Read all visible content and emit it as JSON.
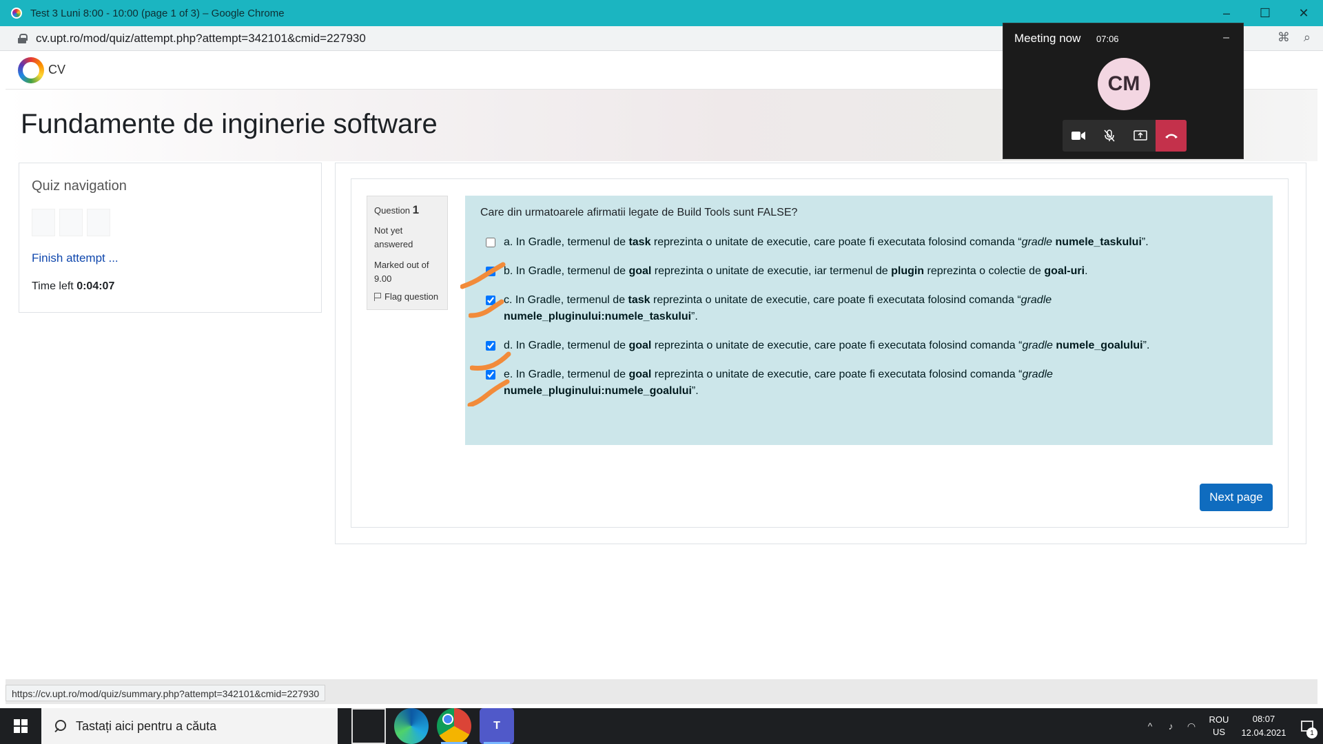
{
  "browser": {
    "window_title": "Test 3 Luni 8:00 - 10:00 (page 1 of 3) – Google Chrome",
    "url": "cv.upt.ro/mod/quiz/attempt.php?attempt=342101&cmid=227930",
    "status_url": "https://cv.upt.ro/mod/quiz/summary.php?attempt=342101&cmid=227930"
  },
  "site": {
    "logo_text": "CV",
    "course_title": "Fundamente de inginerie software"
  },
  "quiz_nav": {
    "heading": "Quiz navigation",
    "finish_attempt": "Finish attempt ...",
    "time_left_label": "Time left",
    "time_left_value": "0:04:07"
  },
  "question": {
    "label": "Question",
    "number": "1",
    "state": "Not yet answered",
    "grade": "Marked out of 9.00",
    "flag": "Flag question",
    "text": "Care din urmatoarele afirmatii legate de Build Tools sunt FALSE?",
    "answers": [
      {
        "prefix": "a. In Gradle, termenul de ",
        "b1": "task",
        "mid": " reprezinta o unitate de executie, care poate fi executata folosind comanda “",
        "em": "gradle",
        "sp": " ",
        "b2": "numele_taskului",
        "end": "”.",
        "checked": false
      },
      {
        "prefix": "b. In Gradle, termenul de ",
        "b1": "goal",
        "mid": " reprezinta o unitate de executie, iar termenul de ",
        "b2": "plugin",
        "mid2": " reprezinta o colectie de ",
        "b3": "goal-uri",
        "end": ".",
        "checked": true
      },
      {
        "prefix": "c. In Gradle, termenul de ",
        "b1": "task",
        "mid": " reprezinta o unitate de executie, care poate fi executata folosind comanda “",
        "em": "gradle",
        "b2": "numele_pluginului:numele_taskului",
        "end": "”.",
        "checked": true
      },
      {
        "prefix": "d. In Gradle, termenul de ",
        "b1": "goal",
        "mid": " reprezinta o unitate de executie, care poate fi executata folosind comanda “",
        "em": "gradle",
        "sp": " ",
        "b2": "numele_goalului",
        "end": "”.",
        "checked": true
      },
      {
        "prefix": "e. In Gradle, termenul de ",
        "b1": "goal",
        "mid": " reprezinta o unitate de executie, care poate fi executata folosind comanda “",
        "em": "gradle",
        "b2": "numele_pluginului:numele_goalului",
        "end": "”.",
        "checked": true
      }
    ],
    "next_button": "Next page"
  },
  "meeting": {
    "title": "Meeting now",
    "elapsed": "07:06",
    "avatar_initials": "CM",
    "controls": [
      "video-icon",
      "mic-off-icon",
      "share-screen-icon",
      "hang-up-icon"
    ],
    "hangup_color": "#c4314b"
  },
  "taskbar": {
    "search_placeholder": "Tastați aici pentru a căuta",
    "lang_top": "ROU",
    "lang_bottom": "US",
    "time": "08:07",
    "date": "12.04.2021",
    "notification_count": "1"
  },
  "colors": {
    "titlebar": "#1bb5c1",
    "question_bg": "#cce6ea",
    "primary_button": "#0f6cbf",
    "check_mark": "#f28b3a"
  }
}
